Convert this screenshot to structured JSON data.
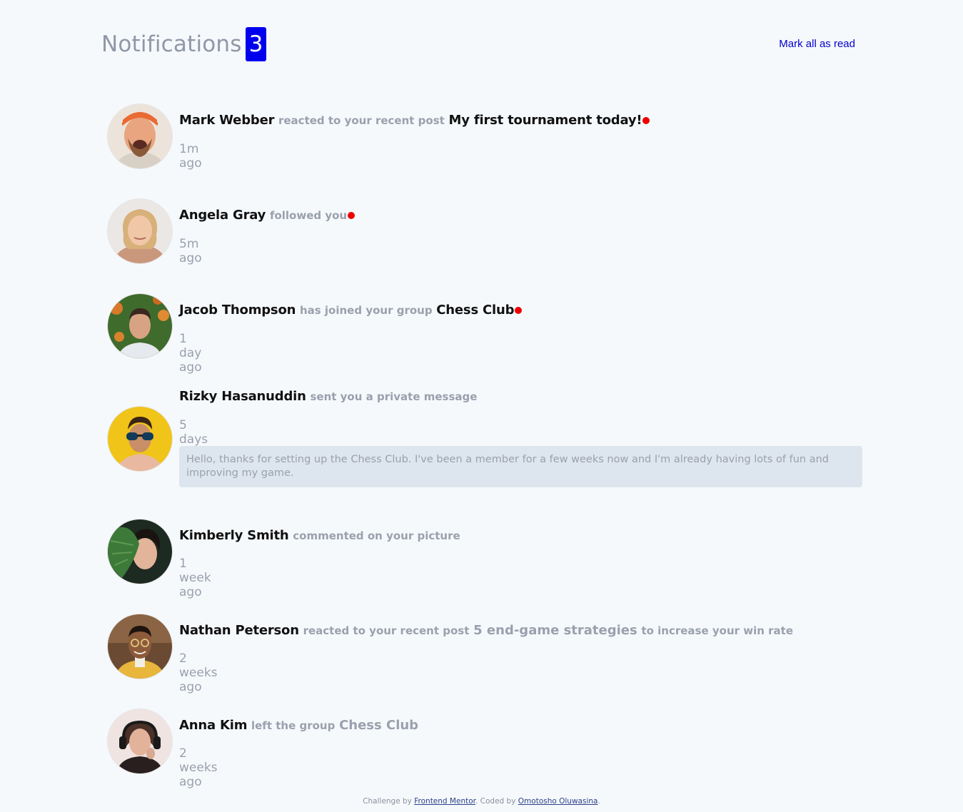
{
  "header": {
    "title": "Notifications",
    "unread_count": "3",
    "mark_all_label": "Mark all as read"
  },
  "colors": {
    "background": "#f6f9fc",
    "badge": "#0000ee",
    "unread_dot": "#ee0000",
    "link": "#0000cc",
    "name": "#111111",
    "muted": "#9aa0ad",
    "message_bg": "#dde6ee"
  },
  "notifications": [
    {
      "name": "Mark Webber",
      "action": "reacted to your recent post",
      "target": "My first tournament today!",
      "time": "1m ago",
      "unread": true
    },
    {
      "name": "Angela Gray",
      "action": "followed you",
      "time": "5m ago",
      "unread": true
    },
    {
      "name": "Jacob Thompson",
      "action": "has joined your group",
      "target": "Chess Club",
      "time": "1 day ago",
      "unread": true
    },
    {
      "name": "Rizky Hasanuddin",
      "action": "sent you a private message",
      "time": "5 days ago",
      "message": "Hello, thanks for setting up the Chess Club. I've been a member for a few weeks now and I'm already having lots of fun and improving my game.",
      "unread": false
    },
    {
      "name": "Kimberly Smith",
      "action": "commented on your picture",
      "time": "1 week ago",
      "unread": false
    },
    {
      "name": "Nathan Peterson",
      "action": "reacted to your recent post",
      "target": "5 end-game strategies",
      "action_suffix": "to increase your win rate",
      "time": "2 weeks ago",
      "unread": false
    },
    {
      "name": "Anna Kim",
      "action": "left the group",
      "target": "Chess Club",
      "time": "2 weeks ago",
      "unread": false
    }
  ],
  "footer": {
    "prefix": "Challenge by",
    "link1": "Frontend Mentor",
    "middle": ". Coded by",
    "link2": "Omotosho Oluwasina",
    "suffix": "."
  }
}
